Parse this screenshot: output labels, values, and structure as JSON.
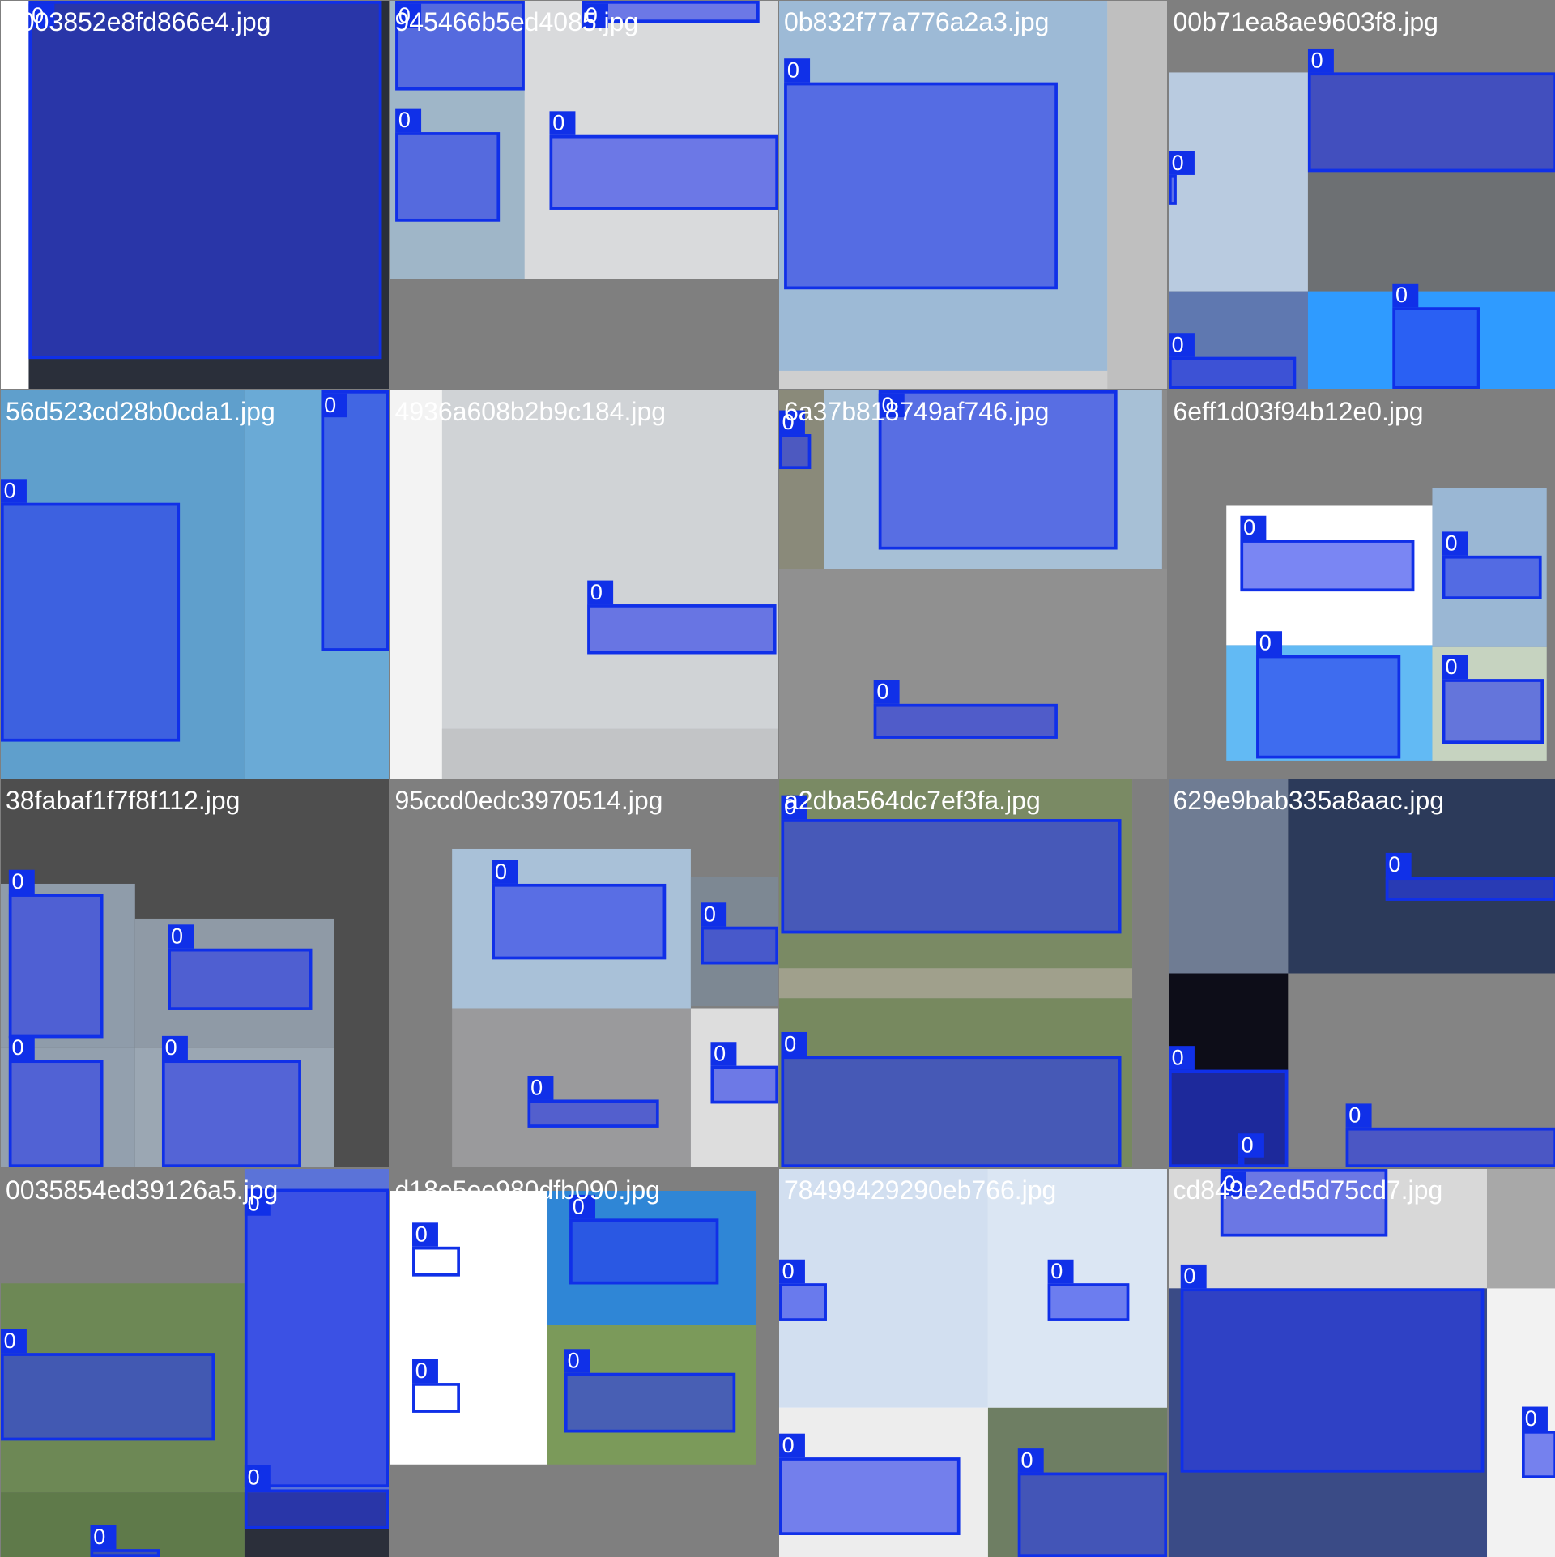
{
  "grid": {
    "colors": {
      "background": "#7f7f7f",
      "box_border": "#1030e8",
      "mask_fill": "rgba(40,60,235,0.62)",
      "label_fg": "#ffffff"
    },
    "tiles": [
      {
        "filename": "b003852e8fd866e4.jpg",
        "labels": [
          "0"
        ]
      },
      {
        "filename": "945466b5ed4085.jpg",
        "labels": [
          "0",
          "0",
          "0",
          "0"
        ]
      },
      {
        "filename": "0b832f77a776a2a3.jpg",
        "labels": [
          "0"
        ]
      },
      {
        "filename": "00b71ea8ae9603f8.jpg",
        "labels": [
          "0",
          "0",
          "0",
          "0"
        ]
      },
      {
        "filename": "56d523cd28b0cda1.jpg",
        "labels": [
          "0",
          "0"
        ]
      },
      {
        "filename": "4936a608b2b9c184.jpg",
        "labels": [
          "0"
        ]
      },
      {
        "filename": "6a37b818749af746.jpg",
        "labels": [
          "0",
          "0",
          "0"
        ]
      },
      {
        "filename": "6eff1d03f94b12e0.jpg",
        "labels": [
          "0",
          "0",
          "0",
          "0"
        ]
      },
      {
        "filename": "38fabaf1f7f8f112.jpg",
        "labels": [
          "0",
          "0",
          "0",
          "0"
        ]
      },
      {
        "filename": "95ccd0edc3970514.jpg",
        "labels": [
          "0",
          "0",
          "0",
          "0"
        ]
      },
      {
        "filename": "a2dba564dc7ef3fa.jpg",
        "labels": [
          "0",
          "0"
        ]
      },
      {
        "filename": "629e9bab335a8aac.jpg",
        "labels": [
          "0",
          "0",
          "0",
          "0"
        ]
      },
      {
        "filename": "0035854ed39126a5.jpg",
        "labels": [
          "0",
          "0",
          "0",
          "0"
        ]
      },
      {
        "filename": "d18e5ee980dfb090.jpg",
        "labels": [
          "0",
          "0",
          "0",
          "0"
        ]
      },
      {
        "filename": "78499429290eb766.jpg",
        "labels": [
          "0",
          "0",
          "0",
          "0"
        ]
      },
      {
        "filename": "cd849e2ed5d75cd7.jpg",
        "labels": [
          "0",
          "0",
          "0"
        ]
      }
    ]
  }
}
